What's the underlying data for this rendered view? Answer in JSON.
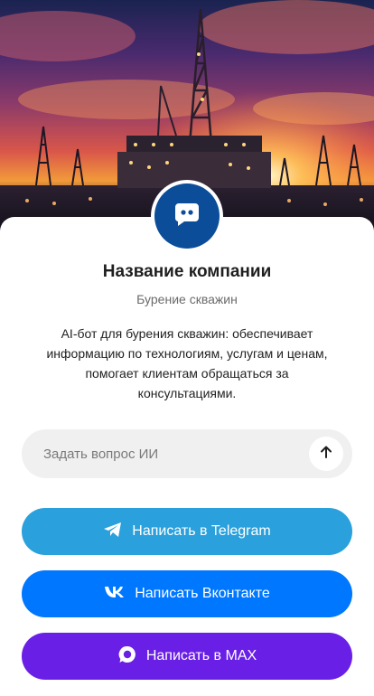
{
  "hero": {
    "image": "oil-drilling-rig-at-sunset"
  },
  "company": {
    "name": "Название компании",
    "subtitle": "Бурение скважин",
    "description": "AI-бот для бурения скважин: обеспечивает информацию по технологиям, услугам и ценам, помогает клиентам обращаться за консультациями.",
    "avatar_icon": "chat-bubble-icon"
  },
  "ask": {
    "placeholder": "Задать вопрос ИИ",
    "value": "",
    "send_icon": "arrow-up-icon"
  },
  "actions": {
    "telegram": {
      "label": "Написать в Telegram",
      "icon": "telegram-icon",
      "color": "#2aa1dc"
    },
    "vk": {
      "label": "Написать Вконтакте",
      "icon": "vk-icon",
      "color": "#0077ff"
    },
    "max": {
      "label": "Написать в MAX",
      "icon": "max-icon",
      "color": "#6a1fe6"
    }
  },
  "colors": {
    "avatar_bg": "#0b4d99",
    "ask_bg": "#f0f0f0"
  }
}
